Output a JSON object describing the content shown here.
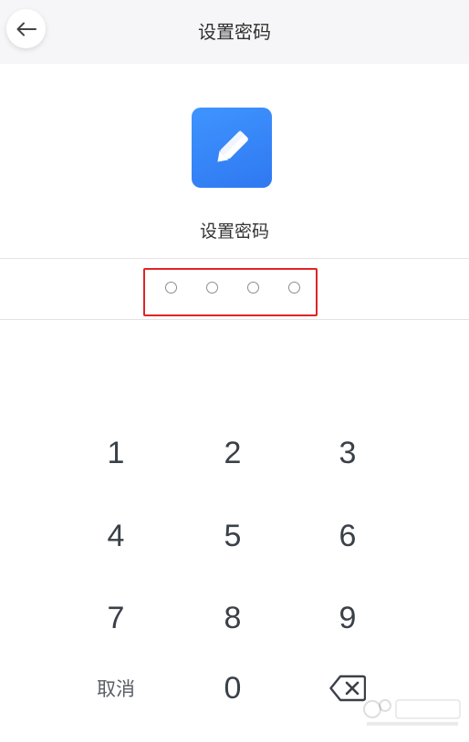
{
  "header": {
    "title": "设置密码"
  },
  "subtitle": "设置密码",
  "keypad": {
    "digits": [
      "1",
      "2",
      "3",
      "4",
      "5",
      "6",
      "7",
      "8",
      "9",
      "0"
    ],
    "cancel_label": "取消"
  },
  "icons": {
    "back": "arrow-left-icon",
    "app": "pencil-edit-icon",
    "delete": "backspace-icon"
  },
  "colors": {
    "accent": "#3f94ff",
    "highlight_border": "#e02424"
  },
  "pin": {
    "length": 4,
    "filled": 0
  }
}
